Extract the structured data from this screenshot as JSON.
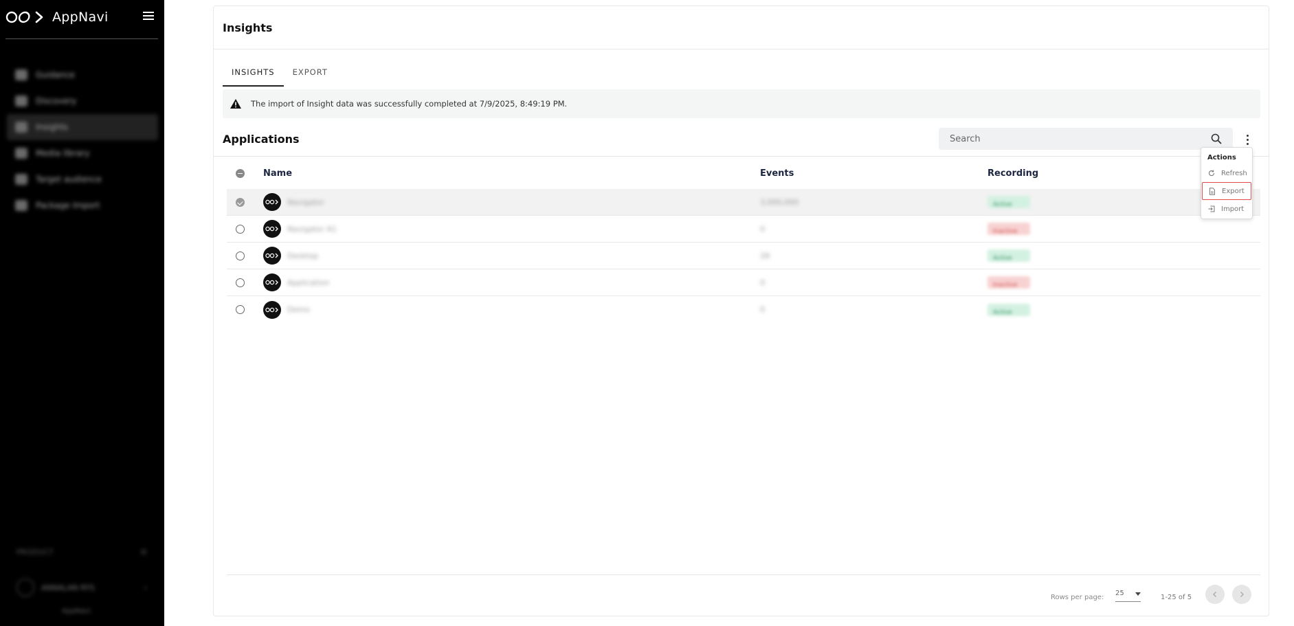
{
  "app": {
    "brand": "AppNavi"
  },
  "sidebar": {
    "items": [
      {
        "label": "Guidance",
        "active": false
      },
      {
        "label": "Discovery",
        "active": false
      },
      {
        "label": "Insights",
        "active": true
      },
      {
        "label": "Media library",
        "active": false
      },
      {
        "label": "Target audience",
        "active": false
      },
      {
        "label": "Package Import",
        "active": false
      }
    ],
    "bottom_label": "PRODUCT",
    "user_name": "ANNALAN RYS",
    "footer": "AppNavi"
  },
  "page": {
    "title": "Insights"
  },
  "tabs": [
    {
      "label": "INSIGHTS",
      "active": true
    },
    {
      "label": "EXPORT",
      "active": false
    }
  ],
  "banner": {
    "icon": "warning-icon",
    "text": "The import of Insight data was successfully completed at 7/9/2025, 8:49:19 PM."
  },
  "applications": {
    "title": "Applications",
    "search_placeholder": "Search",
    "columns": {
      "name": "Name",
      "events": "Events",
      "recording": "Recording"
    },
    "rows": [
      {
        "name": "Navigator",
        "events": "3,000,000",
        "recording": "Active",
        "selected": true
      },
      {
        "name": "Navigator A1",
        "events": "0",
        "recording": "Inactive",
        "selected": false
      },
      {
        "name": "Desktop",
        "events": "28",
        "recording": "Active",
        "selected": false
      },
      {
        "name": "Application",
        "events": "0",
        "recording": "Inactive",
        "selected": false
      },
      {
        "name": "Demo",
        "events": "0",
        "recording": "Active",
        "selected": false
      }
    ]
  },
  "actions_menu": {
    "title": "Actions",
    "items": [
      {
        "label": "Refresh",
        "icon": "refresh-icon"
      },
      {
        "label": "Export",
        "icon": "file-export-icon",
        "highlighted": true
      },
      {
        "label": "Import",
        "icon": "import-icon"
      }
    ]
  },
  "pagination": {
    "rows_per_page_label": "Rows per page:",
    "rows_per_page": "25",
    "range": "1-25 of 5"
  },
  "colors": {
    "sidebar": "#000000",
    "active_badge": "#d3f1e2",
    "inactive_badge": "#f8d2d2",
    "highlight": "#e34b4b"
  }
}
